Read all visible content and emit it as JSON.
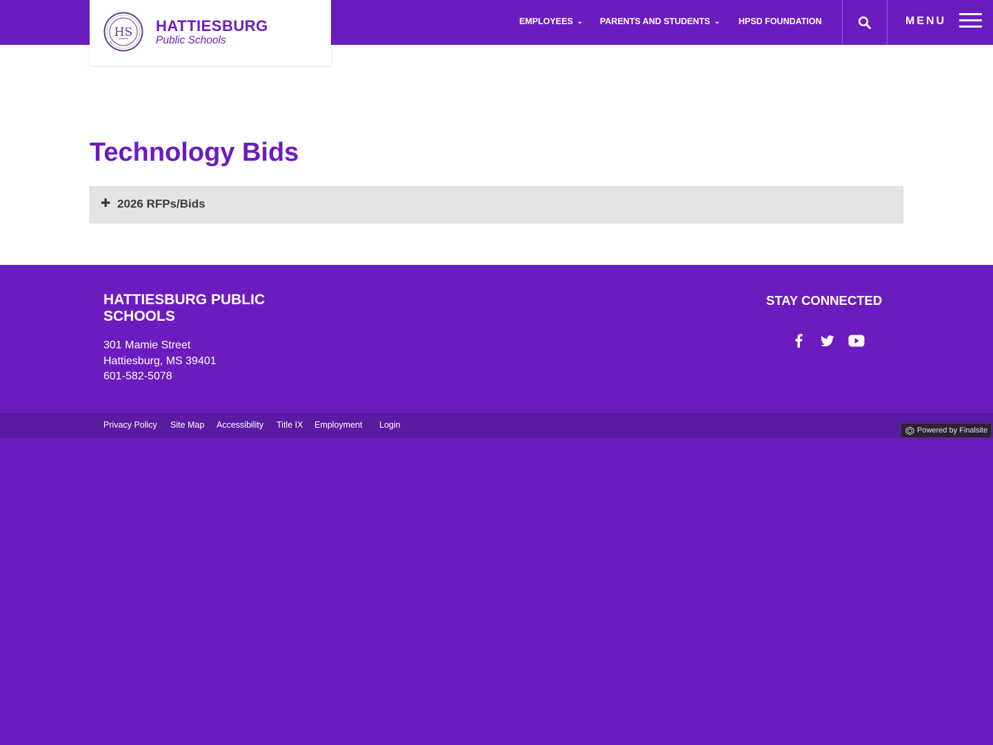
{
  "header": {
    "logo_name": "HATTIESBURG",
    "logo_sub": "Public Schools",
    "seal_text": "HATTIESBURG PUBLIC SCHOOLS HPS",
    "nav": [
      {
        "label": "EMPLOYEES",
        "has_dropdown": true
      },
      {
        "label": "PARENTS AND STUDENTS",
        "has_dropdown": true
      },
      {
        "label": "HPSD FOUNDATION",
        "has_dropdown": false
      }
    ],
    "search_icon": "search-icon",
    "menu_label": "MENU",
    "menu_icon": "hamburger-icon"
  },
  "main": {
    "title": "Technology Bids",
    "accordion": [
      {
        "label": "2026 RFPs/Bids",
        "icon": "plus-icon",
        "expanded": false
      }
    ]
  },
  "footer": {
    "org_name": "HATTIESBURG PUBLIC SCHOOLS",
    "address_line1": "301 Mamie Street",
    "address_line2": "Hattiesburg, MS 39401",
    "phone": "601-582-5078",
    "stay_connected": "STAY CONNECTED",
    "social": [
      "facebook-icon",
      "twitter-icon",
      "youtube-icon"
    ],
    "links": [
      "Privacy Policy",
      "Site Map",
      "Accessibility",
      "Title IX",
      "Employment",
      "Login"
    ],
    "powered_by": "Powered by Finalsite"
  },
  "colors": {
    "brand_purple": "#6b1cbf",
    "bottom_bar": "#5a1aa1",
    "accordion_bg": "#e4e4e4",
    "text_dark": "#3a3a3a"
  }
}
